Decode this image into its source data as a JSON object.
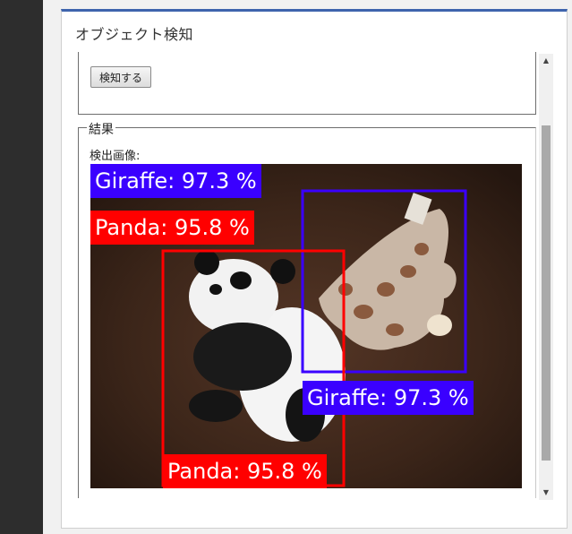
{
  "panel": {
    "title": "オブジェクト検知",
    "accent_color": "#3e64ad"
  },
  "actions": {
    "detect_label": "検知する"
  },
  "result": {
    "legend": "結果",
    "image_label": "検出画像:",
    "detections": [
      {
        "object": "giraffe",
        "label": "Giraffe: 97.3 %",
        "color": "#3a00ff"
      },
      {
        "object": "panda",
        "label": "Panda: 95.8 %",
        "color": "#ff0000"
      }
    ]
  },
  "scrollbar": {
    "up_icon": "▲",
    "down_icon": "▼"
  }
}
